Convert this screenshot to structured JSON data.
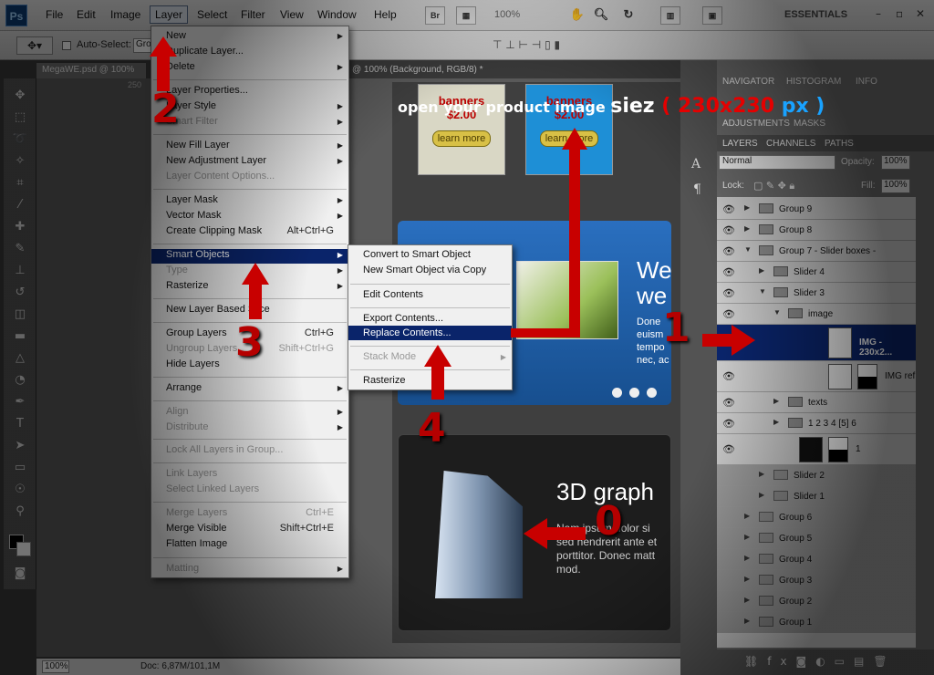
{
  "menubar": {
    "logo": "Ps",
    "items": [
      "File",
      "Edit",
      "Image",
      "Layer",
      "Select",
      "Filter",
      "View",
      "Window",
      "Help"
    ],
    "bridge": "Br",
    "zoom": "100%",
    "workspace": "ESSENTIALS",
    "window_controls": [
      "–",
      "▫",
      "✕"
    ]
  },
  "options": {
    "auto_select": "Auto-Select:",
    "auto_select_target": "Gro"
  },
  "document": {
    "tab1": "MegaWE.psd @ 100%",
    "tab2": "@ 100% (Background, RGB/8) *",
    "ruler_marks": [
      "250"
    ]
  },
  "status": {
    "zoom": "100%",
    "doc": "Doc: 6,87M/101,1M"
  },
  "layer_menu": [
    {
      "label": "New",
      "arrow": true
    },
    {
      "label": "Duplicate Layer..."
    },
    {
      "label": "Delete",
      "arrow": true
    },
    {
      "label": "Layer Properties..."
    },
    {
      "label": "Layer Style",
      "arrow": true
    },
    {
      "label": "Smart Filter",
      "disabled": true,
      "arrow": true
    },
    {
      "label": "New Fill Layer",
      "arrow": true
    },
    {
      "label": "New Adjustment Layer",
      "arrow": true
    },
    {
      "label": "Layer Content Options...",
      "disabled": true
    },
    {
      "label": "Layer Mask",
      "arrow": true
    },
    {
      "label": "Vector Mask",
      "arrow": true
    },
    {
      "label": "Create Clipping Mask",
      "shortcut": "Alt+Ctrl+G"
    },
    {
      "label": "Smart Objects",
      "arrow": true,
      "highlighted": true
    },
    {
      "label": "Type",
      "disabled": true,
      "arrow": true
    },
    {
      "label": "Rasterize",
      "arrow": true
    },
    {
      "label": "New Layer Based Slice"
    },
    {
      "label": "Group Layers",
      "shortcut": "Ctrl+G"
    },
    {
      "label": "Ungroup Layers",
      "shortcut": "Shift+Ctrl+G",
      "disabled": true
    },
    {
      "label": "Hide Layers"
    },
    {
      "label": "Arrange",
      "arrow": true
    },
    {
      "label": "Align",
      "disabled": true,
      "arrow": true
    },
    {
      "label": "Distribute",
      "disabled": true,
      "arrow": true
    },
    {
      "label": "Lock All Layers in Group...",
      "disabled": true
    },
    {
      "label": "Link Layers",
      "disabled": true
    },
    {
      "label": "Select Linked Layers",
      "disabled": true
    },
    {
      "label": "Merge Layers",
      "shortcut": "Ctrl+E",
      "disabled": true
    },
    {
      "label": "Merge Visible",
      "shortcut": "Shift+Ctrl+E"
    },
    {
      "label": "Flatten Image"
    },
    {
      "label": "Matting",
      "disabled": true,
      "arrow": true
    }
  ],
  "smart_submenu": [
    {
      "label": "Convert to Smart Object"
    },
    {
      "label": "New Smart Object via Copy"
    },
    {
      "label": "Edit Contents"
    },
    {
      "label": "Export Contents..."
    },
    {
      "label": "Replace Contents...",
      "highlighted": true
    },
    {
      "label": "Stack Mode",
      "disabled": true,
      "arrow": true
    },
    {
      "label": "Rasterize"
    }
  ],
  "canvas": {
    "banners": [
      {
        "title": "banners",
        "price": "$2.00",
        "button": "learn more"
      },
      {
        "title": "banners",
        "price": "$2.00",
        "button": "learn more"
      }
    ],
    "slider_heading": "We\nwe",
    "slider_text": "Done\neuism\ntempo\nnec, ac",
    "panel3d_heading": "3D graph",
    "panel3d_text": "Nam ipsum dolor si\nsed hendrerit ante et\nporttitor. Donec matt\nmod."
  },
  "right_panels": {
    "top_tabs": [
      "NAVIGATOR",
      "HISTOGRAM",
      "INFO"
    ],
    "second_tabs": [
      "ADJUSTMENTS",
      "MASKS"
    ],
    "layer_tabs": [
      "LAYERS",
      "CHANNELS",
      "PATHS"
    ],
    "blend_mode": "Normal",
    "opacity_label": "Opacity:",
    "opacity": "100%",
    "lock_label": "Lock:",
    "fill_label": "Fill:",
    "fill": "100%"
  },
  "layers": [
    {
      "name": "Group 9",
      "type": "folder",
      "indent": 0,
      "visible": true
    },
    {
      "name": "Group 8",
      "type": "folder",
      "indent": 0,
      "visible": true
    },
    {
      "name": "Group 7 - Slider boxes -",
      "type": "folder",
      "indent": 0,
      "open": true,
      "visible": true
    },
    {
      "name": "Slider 4",
      "type": "folder",
      "indent": 1,
      "visible": true
    },
    {
      "name": "Slider 3",
      "type": "folder",
      "indent": 1,
      "open": true,
      "visible": true
    },
    {
      "name": "image",
      "type": "folder",
      "indent": 2,
      "open": true,
      "visible": true
    },
    {
      "name": "IMG - 230x2...",
      "type": "smart",
      "indent": 3,
      "visible": true,
      "selected": true
    },
    {
      "name": "IMG ref",
      "type": "masked",
      "indent": 3,
      "visible": true
    },
    {
      "name": "texts",
      "type": "folder",
      "indent": 2,
      "visible": true
    },
    {
      "name": "1 2 3 4 [5] 6",
      "type": "folder",
      "indent": 2,
      "visible": true
    },
    {
      "name": "1",
      "type": "masked",
      "indent": 1,
      "visible": true
    },
    {
      "name": "Slider 2",
      "type": "folder",
      "indent": 1,
      "visible": false
    },
    {
      "name": "Slider 1",
      "type": "folder",
      "indent": 1,
      "visible": false
    },
    {
      "name": "Group 6",
      "type": "folder",
      "indent": 0,
      "visible": false
    },
    {
      "name": "Group 5",
      "type": "folder",
      "indent": 0,
      "visible": false
    },
    {
      "name": "Group 4",
      "type": "folder",
      "indent": 0,
      "visible": false
    },
    {
      "name": "Group 3",
      "type": "folder",
      "indent": 0,
      "visible": false
    },
    {
      "name": "Group 2",
      "type": "folder",
      "indent": 0,
      "visible": false
    },
    {
      "name": "Group 1",
      "type": "folder",
      "indent": 0,
      "visible": false
    }
  ],
  "annotations": {
    "instruction_prefix": "open your product  image ",
    "instruction_word": "siez",
    "instruction_dim": " ( 230x230",
    "instruction_unit": " px )",
    "steps": [
      "1",
      "2",
      "3",
      "4",
      "0"
    ]
  },
  "colors": {
    "highlight": "#0a246a",
    "arrow": "#c80000",
    "dim_text": "#e40000",
    "unit_text": "#19a2ff"
  }
}
